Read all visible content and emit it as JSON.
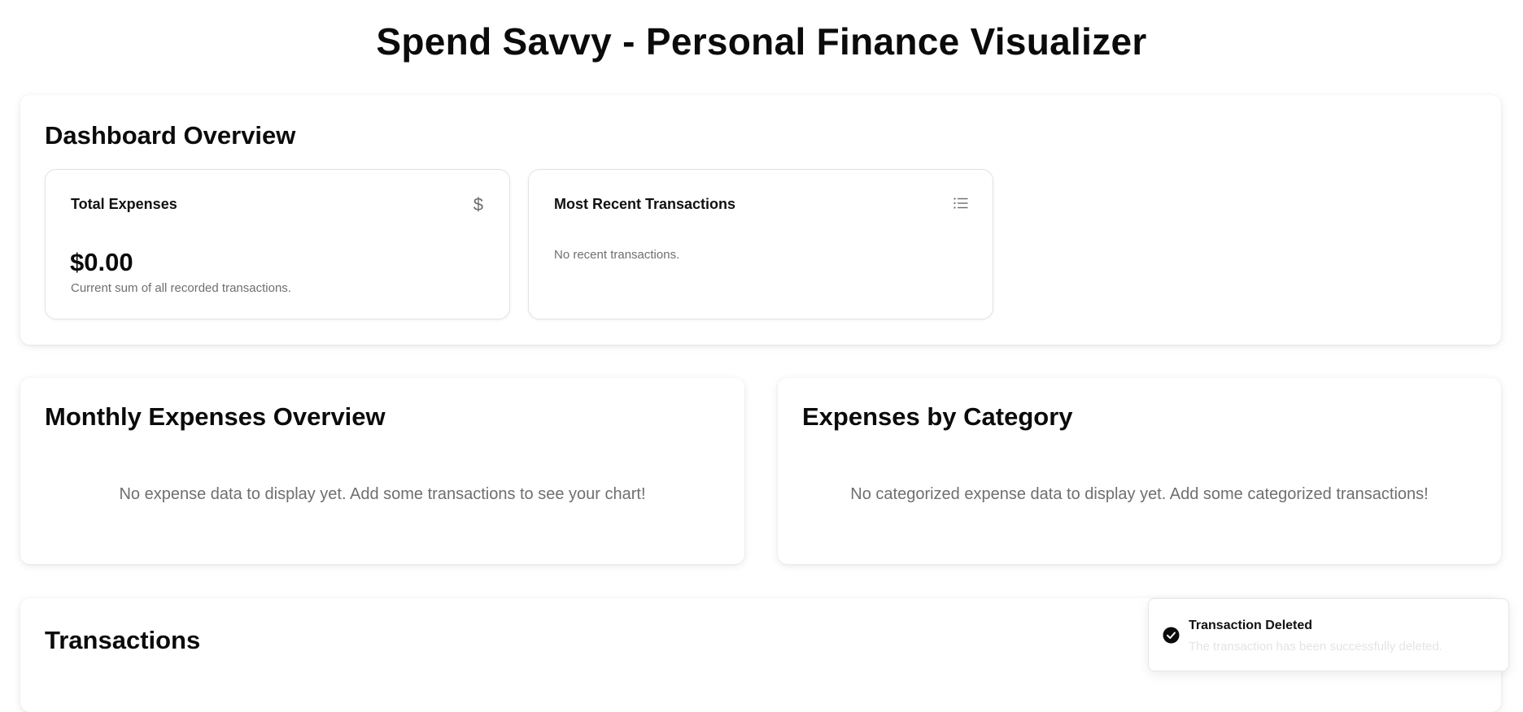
{
  "app": {
    "title": "Spend Savvy - Personal Finance Visualizer"
  },
  "dashboard": {
    "title": "Dashboard Overview",
    "total_expenses": {
      "title": "Total Expenses",
      "icon": "dollar-icon",
      "amount": "$0.00",
      "subtitle": "Current sum of all recorded transactions."
    },
    "recent_transactions": {
      "title": "Most Recent Transactions",
      "icon": "list-icon",
      "empty_text": "No recent transactions."
    }
  },
  "monthly_expenses": {
    "title": "Monthly Expenses Overview",
    "empty_text": "No expense data to display yet. Add some transactions to see your chart!"
  },
  "category_expenses": {
    "title": "Expenses by Category",
    "empty_text": "No categorized expense data to display yet. Add some categorized transactions!"
  },
  "transactions": {
    "title": "Transactions"
  },
  "toast": {
    "icon": "check-circle-icon",
    "title": "Transaction Deleted",
    "description": "The transaction has been successfully deleted."
  }
}
